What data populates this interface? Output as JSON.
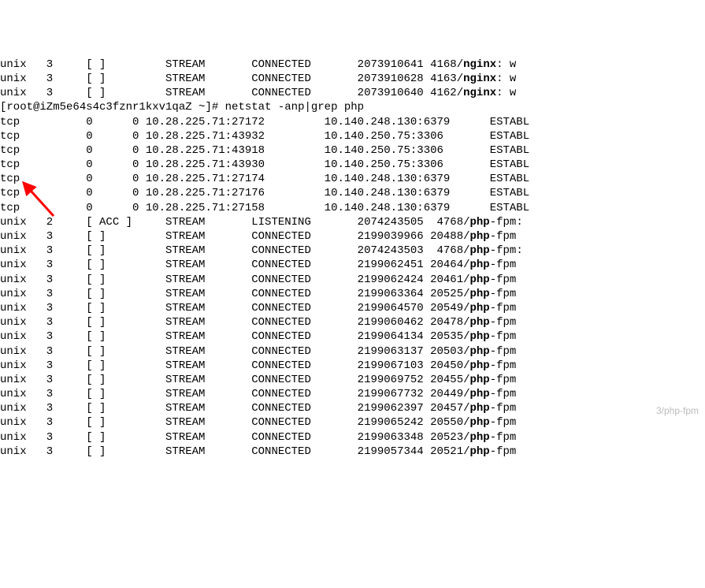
{
  "nginx_lines": [
    {
      "proto": "unix",
      "refcnt": "3",
      "flags": "[ ]",
      "type": "STREAM",
      "state": "CONNECTED",
      "inode": "2073910641",
      "pid": "4168",
      "prog": "nginx",
      "suffix": ": w"
    },
    {
      "proto": "unix",
      "refcnt": "3",
      "flags": "[ ]",
      "type": "STREAM",
      "state": "CONNECTED",
      "inode": "2073910628",
      "pid": "4163",
      "prog": "nginx",
      "suffix": ": w"
    },
    {
      "proto": "unix",
      "refcnt": "3",
      "flags": "[ ]",
      "type": "STREAM",
      "state": "CONNECTED",
      "inode": "2073910640",
      "pid": "4162",
      "prog": "nginx",
      "suffix": ": w"
    }
  ],
  "prompt": "[root@iZm5e64s4c3fznr1kxv1qaZ ~]# ",
  "command": "netstat -anp|grep php",
  "tcp_lines": [
    {
      "proto": "tcp",
      "recvq": "0",
      "sendq": "0",
      "local": "10.28.225.71:27172",
      "foreign": "10.140.248.130:6379",
      "state": "ESTABL"
    },
    {
      "proto": "tcp",
      "recvq": "0",
      "sendq": "0",
      "local": "10.28.225.71:43932",
      "foreign": "10.140.250.75:3306",
      "state": "ESTABL"
    },
    {
      "proto": "tcp",
      "recvq": "0",
      "sendq": "0",
      "local": "10.28.225.71:43918",
      "foreign": "10.140.250.75:3306",
      "state": "ESTABL"
    },
    {
      "proto": "tcp",
      "recvq": "0",
      "sendq": "0",
      "local": "10.28.225.71:43930",
      "foreign": "10.140.250.75:3306",
      "state": "ESTABL"
    },
    {
      "proto": "tcp",
      "recvq": "0",
      "sendq": "0",
      "local": "10.28.225.71:27174",
      "foreign": "10.140.248.130:6379",
      "state": "ESTABL"
    },
    {
      "proto": "tcp",
      "recvq": "0",
      "sendq": "0",
      "local": "10.28.225.71:27176",
      "foreign": "10.140.248.130:6379",
      "state": "ESTABL"
    },
    {
      "proto": "tcp",
      "recvq": "0",
      "sendq": "0",
      "local": "10.28.225.71:27158",
      "foreign": "10.140.248.130:6379",
      "state": "ESTABL"
    }
  ],
  "unix_lines": [
    {
      "proto": "unix",
      "refcnt": "2",
      "flags": "[ ACC ]",
      "type": "STREAM",
      "state": "LISTENING",
      "inode": "2074243505",
      "pid": "4768",
      "prog": "php",
      "suffix": "-fpm:"
    },
    {
      "proto": "unix",
      "refcnt": "3",
      "flags": "[ ]",
      "type": "STREAM",
      "state": "CONNECTED",
      "inode": "2199039966",
      "pid": "20488",
      "prog": "php",
      "suffix": "-fpm"
    },
    {
      "proto": "unix",
      "refcnt": "3",
      "flags": "[ ]",
      "type": "STREAM",
      "state": "CONNECTED",
      "inode": "2074243503",
      "pid": "4768",
      "prog": "php",
      "suffix": "-fpm:"
    },
    {
      "proto": "unix",
      "refcnt": "3",
      "flags": "[ ]",
      "type": "STREAM",
      "state": "CONNECTED",
      "inode": "2199062451",
      "pid": "20464",
      "prog": "php",
      "suffix": "-fpm"
    },
    {
      "proto": "unix",
      "refcnt": "3",
      "flags": "[ ]",
      "type": "STREAM",
      "state": "CONNECTED",
      "inode": "2199062424",
      "pid": "20461",
      "prog": "php",
      "suffix": "-fpm"
    },
    {
      "proto": "unix",
      "refcnt": "3",
      "flags": "[ ]",
      "type": "STREAM",
      "state": "CONNECTED",
      "inode": "2199063364",
      "pid": "20525",
      "prog": "php",
      "suffix": "-fpm"
    },
    {
      "proto": "unix",
      "refcnt": "3",
      "flags": "[ ]",
      "type": "STREAM",
      "state": "CONNECTED",
      "inode": "2199064570",
      "pid": "20549",
      "prog": "php",
      "suffix": "-fpm"
    },
    {
      "proto": "unix",
      "refcnt": "3",
      "flags": "[ ]",
      "type": "STREAM",
      "state": "CONNECTED",
      "inode": "2199060462",
      "pid": "20478",
      "prog": "php",
      "suffix": "-fpm"
    },
    {
      "proto": "unix",
      "refcnt": "3",
      "flags": "[ ]",
      "type": "STREAM",
      "state": "CONNECTED",
      "inode": "2199064134",
      "pid": "20535",
      "prog": "php",
      "suffix": "-fpm"
    },
    {
      "proto": "unix",
      "refcnt": "3",
      "flags": "[ ]",
      "type": "STREAM",
      "state": "CONNECTED",
      "inode": "2199063137",
      "pid": "20503",
      "prog": "php",
      "suffix": "-fpm"
    },
    {
      "proto": "unix",
      "refcnt": "3",
      "flags": "[ ]",
      "type": "STREAM",
      "state": "CONNECTED",
      "inode": "2199067103",
      "pid": "20450",
      "prog": "php",
      "suffix": "-fpm"
    },
    {
      "proto": "unix",
      "refcnt": "3",
      "flags": "[ ]",
      "type": "STREAM",
      "state": "CONNECTED",
      "inode": "2199069752",
      "pid": "20455",
      "prog": "php",
      "suffix": "-fpm"
    },
    {
      "proto": "unix",
      "refcnt": "3",
      "flags": "[ ]",
      "type": "STREAM",
      "state": "CONNECTED",
      "inode": "2199067732",
      "pid": "20449",
      "prog": "php",
      "suffix": "-fpm"
    },
    {
      "proto": "unix",
      "refcnt": "3",
      "flags": "[ ]",
      "type": "STREAM",
      "state": "CONNECTED",
      "inode": "2199062397",
      "pid": "20457",
      "prog": "php",
      "suffix": "-fpm"
    },
    {
      "proto": "unix",
      "refcnt": "3",
      "flags": "[ ]",
      "type": "STREAM",
      "state": "CONNECTED",
      "inode": "2199065242",
      "pid": "20550",
      "prog": "php",
      "suffix": "-fpm"
    },
    {
      "proto": "unix",
      "refcnt": "3",
      "flags": "[ ]",
      "type": "STREAM",
      "state": "CONNECTED",
      "inode": "2199063348",
      "pid": "20523",
      "prog": "php",
      "suffix": "-fpm"
    },
    {
      "proto": "unix",
      "refcnt": "3",
      "flags": "[ ]",
      "type": "STREAM",
      "state": "CONNECTED",
      "inode": "2199057344",
      "pid": "20521",
      "prog": "php",
      "suffix": "-fpm"
    }
  ],
  "watermark": "3/php-fpm"
}
